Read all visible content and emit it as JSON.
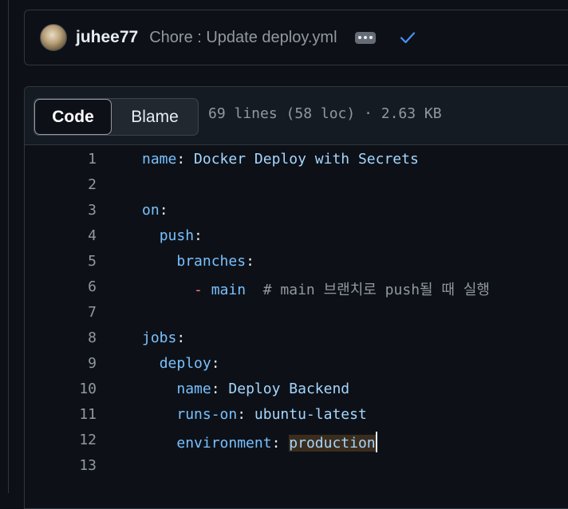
{
  "commit": {
    "author": "juhee77",
    "message": "Chore : Update deploy.yml",
    "more_icon": "kebab-horizontal-icon",
    "status_icon": "check-icon"
  },
  "file_header": {
    "tabs": [
      {
        "label": "Code",
        "selected": true
      },
      {
        "label": "Blame",
        "selected": false
      }
    ],
    "meta": "69 lines (58 loc) · 2.63 KB"
  },
  "code": {
    "lines": [
      {
        "n": "1",
        "indent": "",
        "key": "name",
        "sep": ": ",
        "value": "Docker Deploy with Secrets"
      },
      {
        "n": "2"
      },
      {
        "n": "3",
        "indent": "",
        "key": "on",
        "sep": ":"
      },
      {
        "n": "4",
        "indent": "  ",
        "key": "push",
        "sep": ":"
      },
      {
        "n": "5",
        "indent": "    ",
        "key": "branches",
        "sep": ":"
      },
      {
        "n": "6",
        "indent": "      ",
        "dash": "- ",
        "value": "main",
        "comment": "  # main 브랜치로 push될 때 실행"
      },
      {
        "n": "7"
      },
      {
        "n": "8",
        "indent": "",
        "key": "jobs",
        "sep": ":"
      },
      {
        "n": "9",
        "indent": "  ",
        "key": "deploy",
        "sep": ":"
      },
      {
        "n": "10",
        "indent": "    ",
        "key": "name",
        "sep": ": ",
        "value": "Deploy Backend"
      },
      {
        "n": "11",
        "indent": "    ",
        "key": "runs-on",
        "sep": ": ",
        "value": "ubuntu-latest"
      },
      {
        "n": "12",
        "indent": "    ",
        "key": "environment",
        "sep": ": ",
        "value": "production",
        "selected": true
      },
      {
        "n": "13"
      }
    ]
  },
  "colors": {
    "background": "#0d1117",
    "border": "#30363d",
    "key": "#7ee787",
    "string": "#a5d6ff",
    "comment": "#9198a1"
  }
}
